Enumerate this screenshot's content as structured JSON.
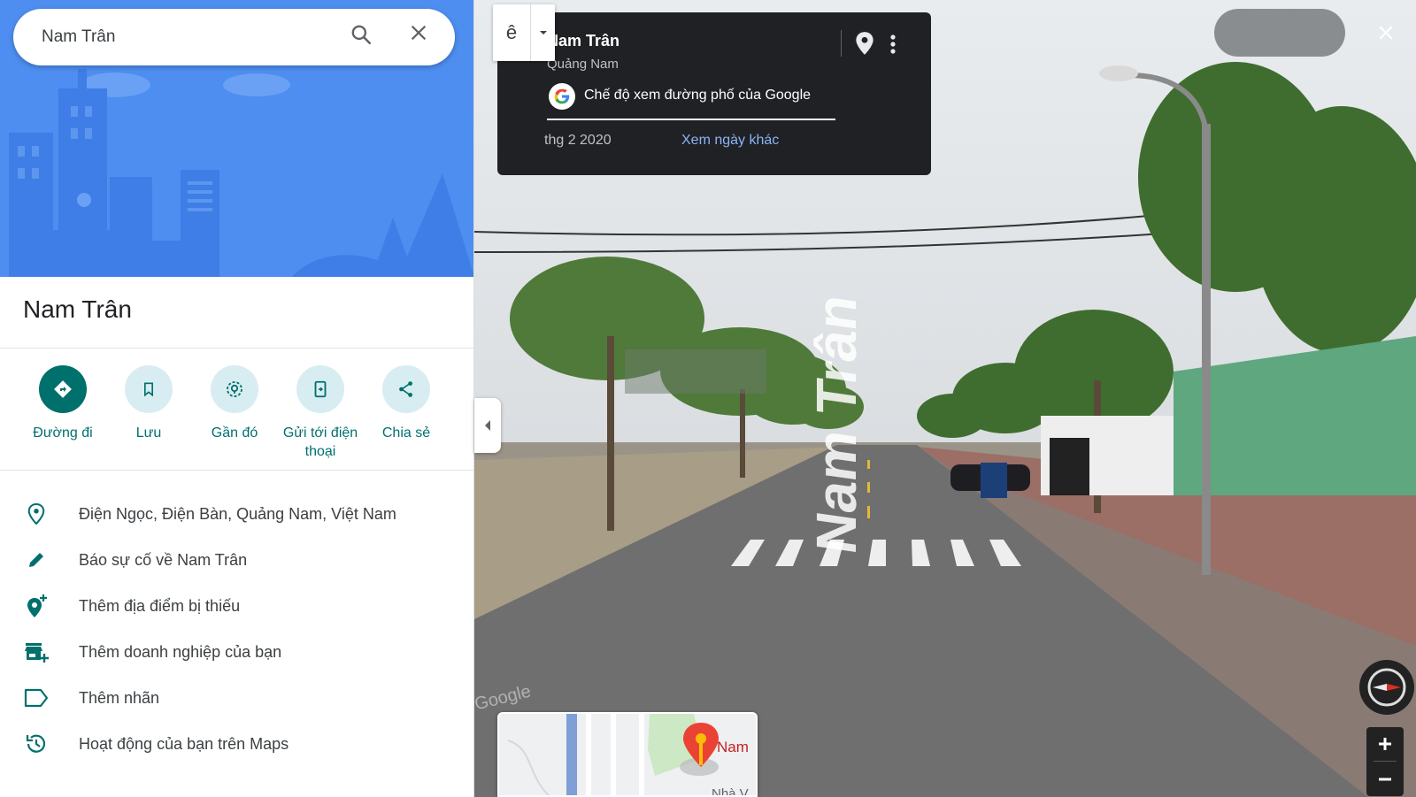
{
  "search": {
    "value": "Nam Trân",
    "search_icon": "search-icon",
    "clear_icon": "close-icon"
  },
  "place": {
    "title": "Nam Trân"
  },
  "actions": [
    {
      "label": "Đường đi",
      "icon": "directions-icon"
    },
    {
      "label": "Lưu",
      "icon": "bookmark-icon"
    },
    {
      "label": "Gần đó",
      "icon": "nearby-icon"
    },
    {
      "label": "Gửi tới điện thoại",
      "icon": "send-to-phone-icon"
    },
    {
      "label": "Chia sẻ",
      "icon": "share-icon"
    }
  ],
  "details": [
    {
      "text": "Điện Ngọc, Điện Bàn, Quảng Nam, Việt Nam",
      "icon": "location-pin-icon"
    },
    {
      "text": "Báo sự cố về Nam Trân",
      "icon": "pencil-icon"
    },
    {
      "text": "Thêm địa điểm bị thiếu",
      "icon": "add-place-icon"
    },
    {
      "text": "Thêm doanh nghiệp của bạn",
      "icon": "add-business-icon"
    },
    {
      "text": "Thêm nhãn",
      "icon": "label-icon"
    },
    {
      "text": "Hoạt động của bạn trên Maps",
      "icon": "history-icon"
    }
  ],
  "street_view": {
    "title": "Nam Trân",
    "subtitle": "Quảng Nam",
    "provider": "Chế độ xem đường phố của Google",
    "date": "thg 2 2020",
    "other_dates": "Xem ngày khác",
    "mode_glyph": "ê",
    "road_marking": "Nam Trân",
    "watermark": "Google"
  },
  "minimap": {
    "label": "Nam",
    "label2": "Nhà V"
  },
  "colors": {
    "accent": "#00706d",
    "hero_blue": "#4d8ef0",
    "card_bg": "#202124",
    "link": "#8ab4f8"
  }
}
